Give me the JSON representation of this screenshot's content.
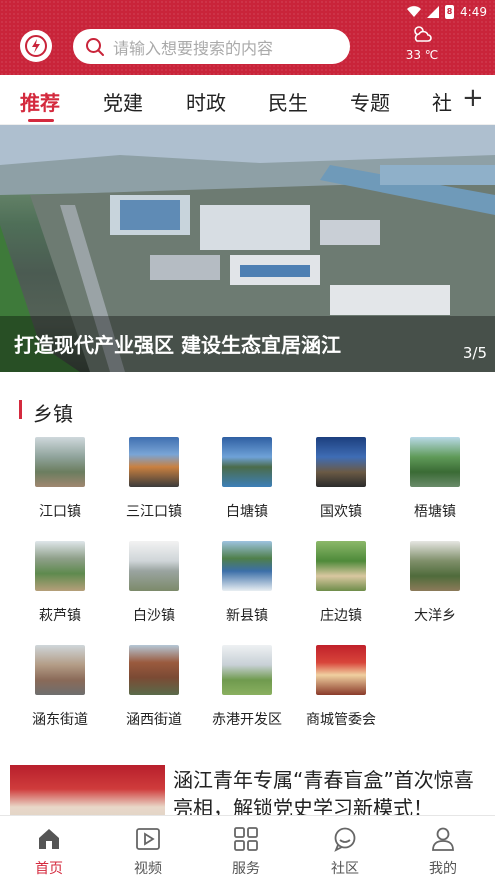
{
  "status_bar": {
    "time": "4:49",
    "battery": "8"
  },
  "search": {
    "placeholder": "请输入想要搜索的内容"
  },
  "weather": {
    "temperature": "33 ℃",
    "icon": "cloud-sun-icon"
  },
  "tabs": [
    "推荐",
    "党建",
    "时政",
    "民生",
    "专题",
    "社"
  ],
  "active_tab": "推荐",
  "banner": {
    "title": "打造现代产业强区  建设生态宜居涵江",
    "page": "3/5"
  },
  "section": {
    "title": "乡镇"
  },
  "towns": [
    {
      "label": "江口镇"
    },
    {
      "label": "三江口镇"
    },
    {
      "label": "白塘镇"
    },
    {
      "label": "国欢镇"
    },
    {
      "label": "梧塘镇"
    },
    {
      "label": "萩芦镇"
    },
    {
      "label": "白沙镇"
    },
    {
      "label": "新县镇"
    },
    {
      "label": "庄边镇"
    },
    {
      "label": "大洋乡"
    },
    {
      "label": "涵东街道"
    },
    {
      "label": "涵西街道"
    },
    {
      "label": "赤港开发区"
    },
    {
      "label": "商城管委会"
    }
  ],
  "news": {
    "title": "涵江青年专属“青春盲盒”首次惊喜亮相，解锁党史学习新模式！"
  },
  "bottom_nav": [
    {
      "label": "首页",
      "icon": "home-icon"
    },
    {
      "label": "视频",
      "icon": "video-icon"
    },
    {
      "label": "服务",
      "icon": "grid-icon"
    },
    {
      "label": "社区",
      "icon": "chat-icon"
    },
    {
      "label": "我的",
      "icon": "user-icon"
    }
  ],
  "colors": {
    "brand": "#c9243a",
    "accent": "#d42a3e"
  }
}
